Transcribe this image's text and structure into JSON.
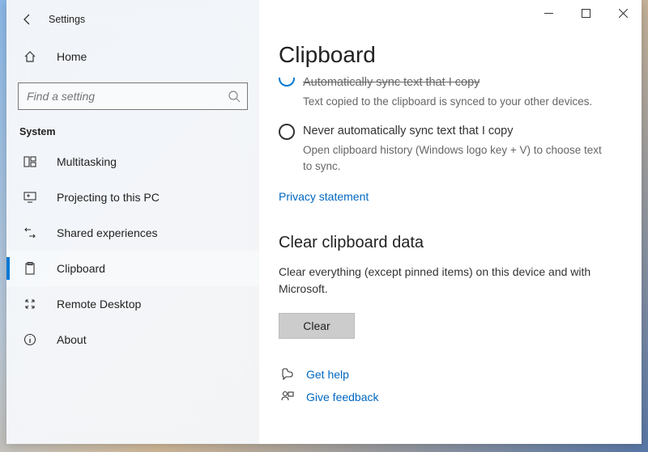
{
  "app_title": "Settings",
  "home_label": "Home",
  "search_placeholder": "Find a setting",
  "section_label": "System",
  "nav_items": [
    {
      "label": "Multitasking"
    },
    {
      "label": "Projecting to this PC"
    },
    {
      "label": "Shared experiences"
    },
    {
      "label": "Clipboard"
    },
    {
      "label": "Remote Desktop"
    },
    {
      "label": "About"
    }
  ],
  "page": {
    "title": "Clipboard",
    "option1": {
      "label": "Automatically sync text that I copy",
      "desc": "Text copied to the clipboard is synced to your other devices."
    },
    "option2": {
      "label": "Never automatically sync text that I copy",
      "desc": "Open clipboard history (Windows logo key + V) to choose text to sync."
    },
    "privacy_link": "Privacy statement",
    "clear": {
      "heading": "Clear clipboard data",
      "desc": "Clear everything (except pinned items) on this device and with Microsoft.",
      "button": "Clear"
    },
    "get_help": "Get help",
    "give_feedback": "Give feedback"
  }
}
